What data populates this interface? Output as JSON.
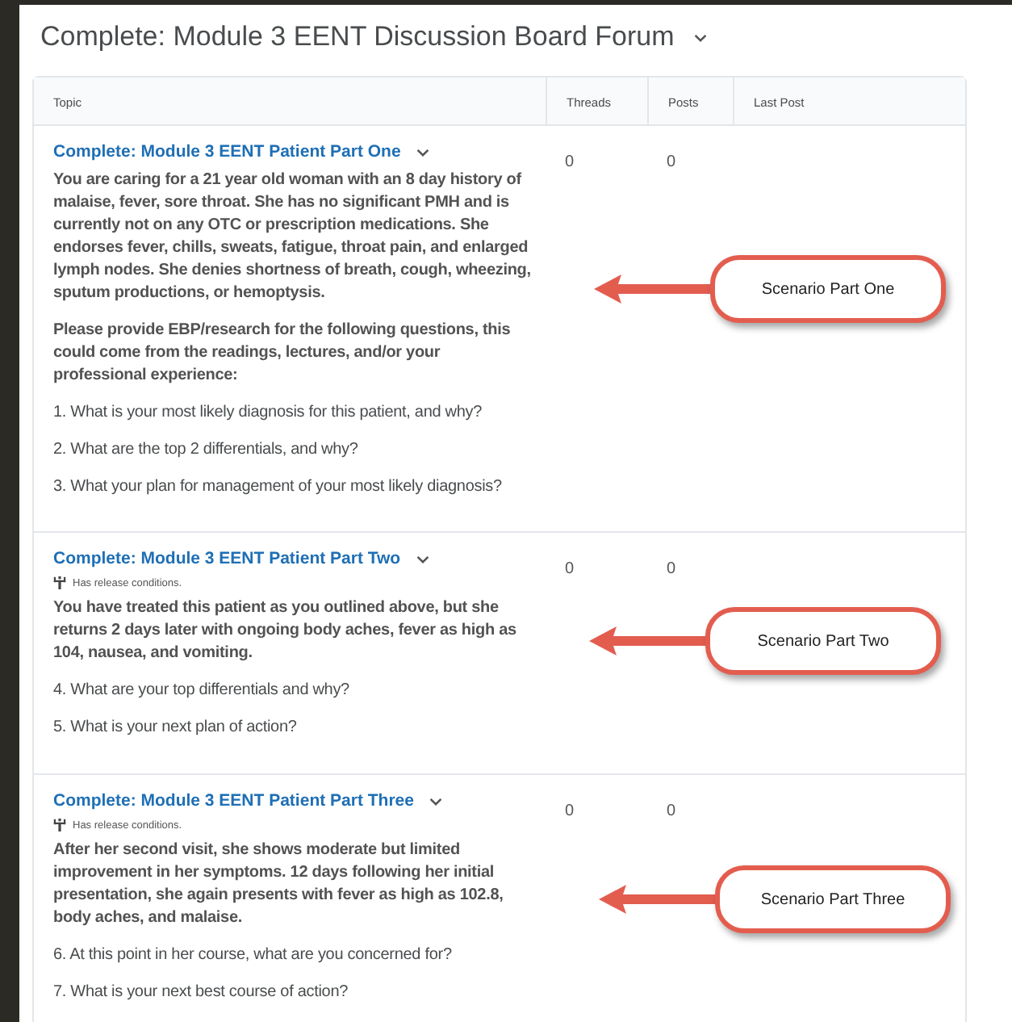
{
  "forum": {
    "title": "Complete: Module 3 EENT Discussion Board Forum"
  },
  "table": {
    "columns": [
      "Topic",
      "Threads",
      "Posts",
      "Last Post"
    ],
    "rows": [
      {
        "title": "Complete: Module 3 EENT Patient Part One",
        "threads": "0",
        "posts": "0",
        "paragraphs": [
          {
            "kind": "description",
            "text": "You are caring for a 21 year old woman with an 8 day history of malaise, fever, sore throat. She has no significant PMH and is currently not on any OTC or prescription medications. She endorses fever, chills, sweats, fatigue, throat pain, and enlarged lymph nodes. She denies shortness of breath, cough, wheezing, sputum productions, or hemoptysis."
          },
          {
            "kind": "description",
            "text": "Please provide EBP/research for the following questions, this could come from the readings, lectures, and/or your professional experience:"
          },
          {
            "kind": "question",
            "text": "1. What is your most likely diagnosis for this patient, and why?"
          },
          {
            "kind": "question",
            "text": "2. What are the top 2 differentials, and why?"
          },
          {
            "kind": "question",
            "text": "3. What your plan for management of your most likely diagnosis?"
          }
        ],
        "callout": "Scenario Part One"
      },
      {
        "title": "Complete: Module 3 EENT Patient Part Two",
        "threads": "0",
        "posts": "0",
        "release_note": "Has release conditions.",
        "paragraphs": [
          {
            "kind": "description",
            "text": "You have treated this patient as you outlined above, but she returns 2 days later with ongoing body aches, fever as high as 104, nausea, and vomiting."
          },
          {
            "kind": "question",
            "text": "4. What are your top differentials and why?"
          },
          {
            "kind": "question",
            "text": "5. What is your next plan of action?"
          }
        ],
        "callout": "Scenario Part Two"
      },
      {
        "title": "Complete: Module 3 EENT Patient Part Three",
        "threads": "0",
        "posts": "0",
        "release_note": "Has release conditions.",
        "paragraphs": [
          {
            "kind": "description",
            "text": "After her second visit, she shows moderate but limited improvement in her symptoms. 12 days following her initial presentation, she again presents with fever as high as 102.8, body aches, and malaise."
          },
          {
            "kind": "question",
            "text": "6. At this point in her course, what are you concerned for?"
          },
          {
            "kind": "question",
            "text": "7. What is your next best course of action?"
          }
        ],
        "callout": "Scenario Part Three"
      }
    ]
  }
}
